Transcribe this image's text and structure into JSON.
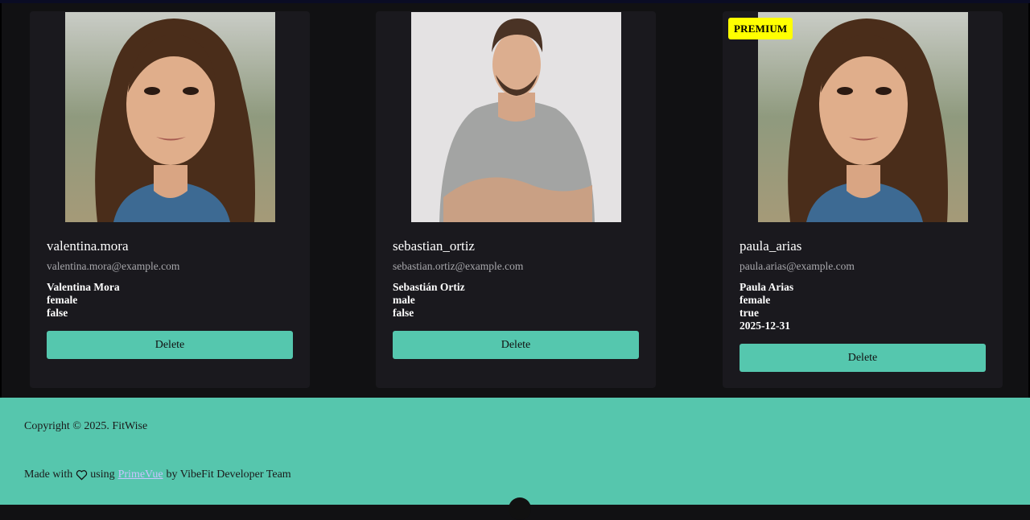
{
  "cards": [
    {
      "username": "valentina.mora",
      "email": "valentina.mora@example.com",
      "full_name": "Valentina Mora",
      "gender": "female",
      "premium": "false",
      "expiry": "",
      "badge": "",
      "delete_label": "Delete",
      "photo_icon": "portrait-woman-icon"
    },
    {
      "username": "sebastian_ortiz",
      "email": "sebastian.ortiz@example.com",
      "full_name": "Sebastián Ortiz",
      "gender": "male",
      "premium": "false",
      "expiry": "",
      "badge": "",
      "delete_label": "Delete",
      "photo_icon": "portrait-man-icon"
    },
    {
      "username": "paula_arias",
      "email": "paula.arias@example.com",
      "full_name": "Paula Arias",
      "gender": "female",
      "premium": "true",
      "expiry": "2025-12-31",
      "badge": "PREMIUM",
      "delete_label": "Delete",
      "photo_icon": "portrait-woman-icon"
    }
  ],
  "footer": {
    "copyright": "Copyright © 2025. FitWise",
    "made_with": "Made with",
    "using": "using",
    "link": "PrimeVue",
    "by": "by VibeFit Developer Team"
  },
  "colors": {
    "accent": "#56c6ad",
    "card_bg": "#1a191e",
    "badge": "#ffff00"
  }
}
